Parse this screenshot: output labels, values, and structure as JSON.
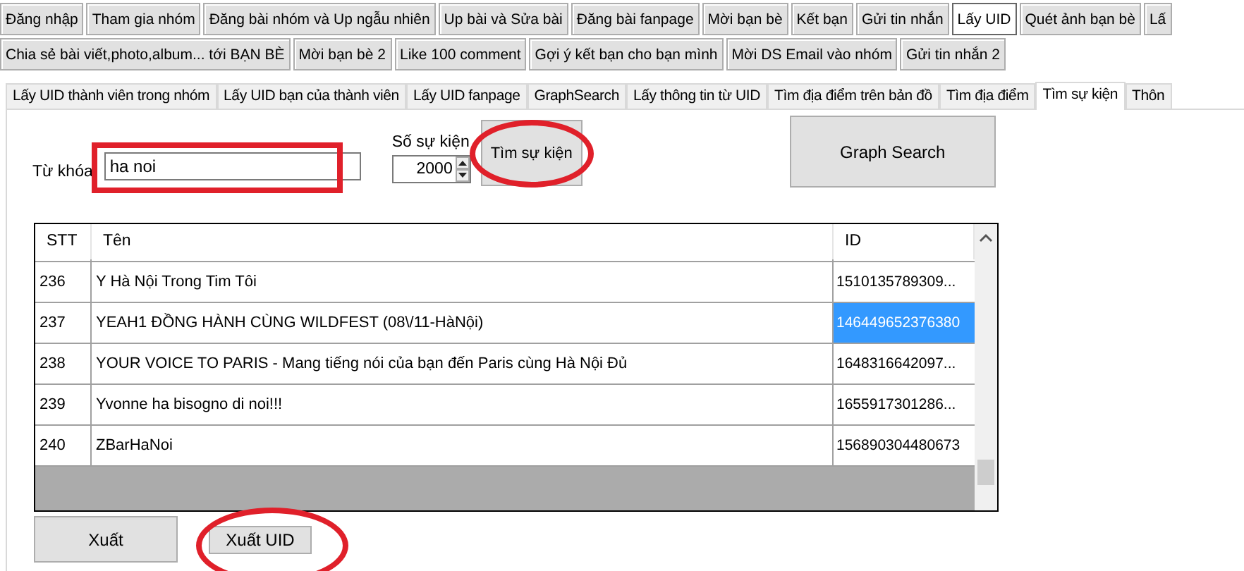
{
  "toolbar_row_1": [
    {
      "label": "Đăng nhập",
      "selected": false
    },
    {
      "label": "Tham gia nhóm",
      "selected": false
    },
    {
      "label": "Đăng bài nhóm và Up ngẫu nhiên",
      "selected": false
    },
    {
      "label": "Up bài và Sửa bài",
      "selected": false
    },
    {
      "label": "Đăng bài fanpage",
      "selected": false
    },
    {
      "label": "Mời bạn bè",
      "selected": false
    },
    {
      "label": "Kết bạn",
      "selected": false
    },
    {
      "label": "Gửi tin nhắn",
      "selected": false
    },
    {
      "label": "Lấy UID",
      "selected": true
    },
    {
      "label": "Quét ảnh bạn bè",
      "selected": false
    },
    {
      "label": "Lấ",
      "selected": false
    }
  ],
  "toolbar_row_2": [
    {
      "label": "Chia sẻ bài viết,photo,album... tới BẠN BÈ",
      "selected": false
    },
    {
      "label": "Mời bạn bè 2",
      "selected": false
    },
    {
      "label": "Like 100 comment",
      "selected": false
    },
    {
      "label": "Gợi ý kết bạn cho bạn mình",
      "selected": false
    },
    {
      "label": "Mời DS Email vào nhóm",
      "selected": false
    },
    {
      "label": "Gửi tin nhắn 2",
      "selected": false
    }
  ],
  "tabs": [
    {
      "label": "Lấy UID thành viên trong nhóm",
      "selected": false
    },
    {
      "label": "Lấy UID bạn của thành viên",
      "selected": false
    },
    {
      "label": "Lấy UID fanpage",
      "selected": false
    },
    {
      "label": "GraphSearch",
      "selected": false
    },
    {
      "label": "Lấy thông tin từ UID",
      "selected": false
    },
    {
      "label": "Tìm địa điểm trên bản đồ",
      "selected": false
    },
    {
      "label": "Tìm địa điểm",
      "selected": false
    },
    {
      "label": "Tìm sự kiện",
      "selected": true
    },
    {
      "label": "Thôn",
      "selected": false
    }
  ],
  "keyword": {
    "label": "Từ khóa",
    "value": "ha noi"
  },
  "event_count": {
    "label": "Số sự kiện",
    "value": "2000"
  },
  "search_button": "Tìm sự kiện",
  "graph_search_button": "Graph Search",
  "table": {
    "columns": [
      "STT",
      "Tên",
      "ID"
    ],
    "rows": [
      {
        "stt": "236",
        "name": "Y Hà Nội Trong Tim Tôi",
        "id": "1510135789309...",
        "selected": false
      },
      {
        "stt": "237",
        "name": "YEAH1 ĐỒNG HÀNH CÙNG WILDFEST (08\\/11-HàNội)",
        "id": "146449652376380",
        "selected": true
      },
      {
        "stt": "238",
        "name": "YOUR VOICE TO PARIS - Mang tiếng nói của bạn đến Paris cùng Hà Nội Đủ",
        "id": "1648316642097...",
        "selected": false
      },
      {
        "stt": "239",
        "name": "Yvonne ha bisogno di noi!!!",
        "id": "1655917301286...",
        "selected": false
      },
      {
        "stt": "240",
        "name": "ZBarHaNoi",
        "id": "156890304480673",
        "selected": false
      }
    ]
  },
  "export_button": "Xuất",
  "export_uid_button": "Xuất UID"
}
